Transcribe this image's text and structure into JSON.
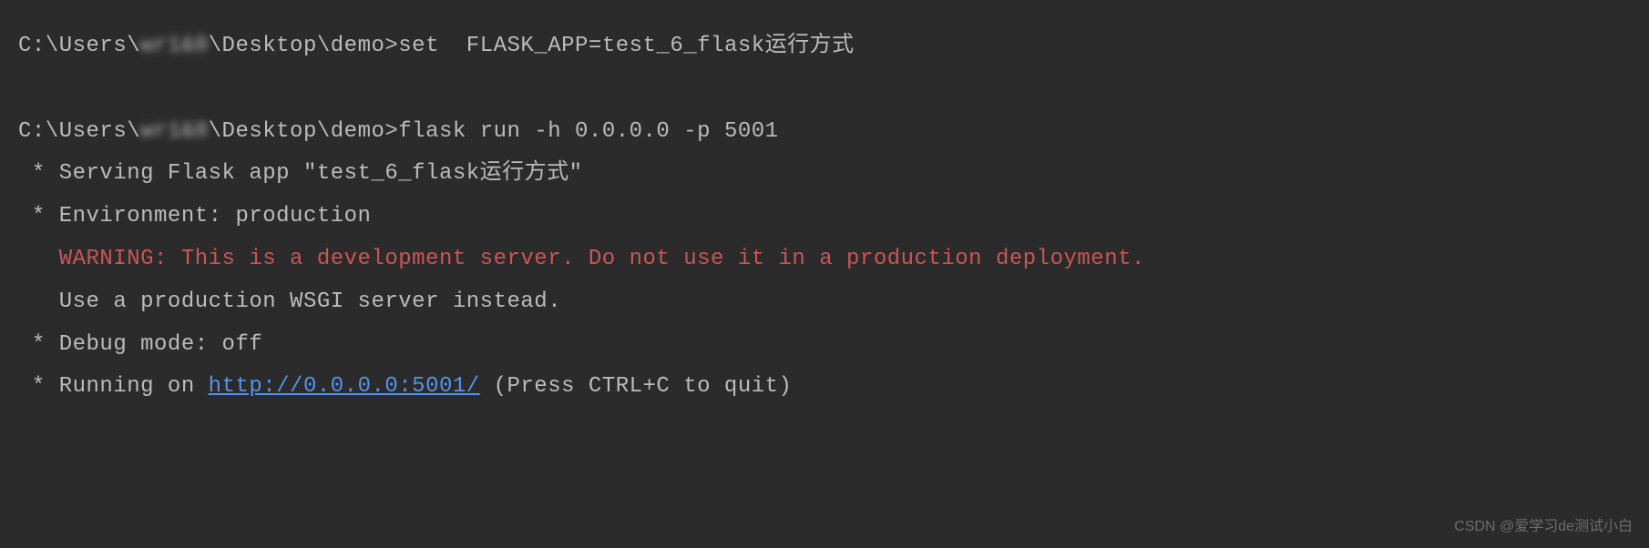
{
  "terminal": {
    "line1_prompt_prefix": "C:\\Users\\",
    "line1_user_blur": "wr1&0",
    "line1_prompt_suffix": "\\Desktop\\demo>",
    "line1_command": "set  FLASK_APP=test_6_flask运行方式",
    "line2_prompt_prefix": "C:\\Users\\",
    "line2_user_blur": "wr1&0",
    "line2_prompt_suffix": "\\Desktop\\demo>",
    "line2_command": "flask run -h 0.0.0.0 -p 5001",
    "output_serving": " * Serving Flask app \"test_6_flask运行方式\"",
    "output_env": " * Environment: production",
    "output_warning": "   WARNING: This is a development server. Do not use it in a production deployment.",
    "output_wsgi": "   Use a production WSGI server instead.",
    "output_debug": " * Debug mode: off",
    "output_running_prefix": " * Running on ",
    "output_running_url": "http://0.0.0.0:5001/",
    "output_running_suffix": " (Press CTRL+C to quit)"
  },
  "watermark": "CSDN @爱学习de测试小白"
}
